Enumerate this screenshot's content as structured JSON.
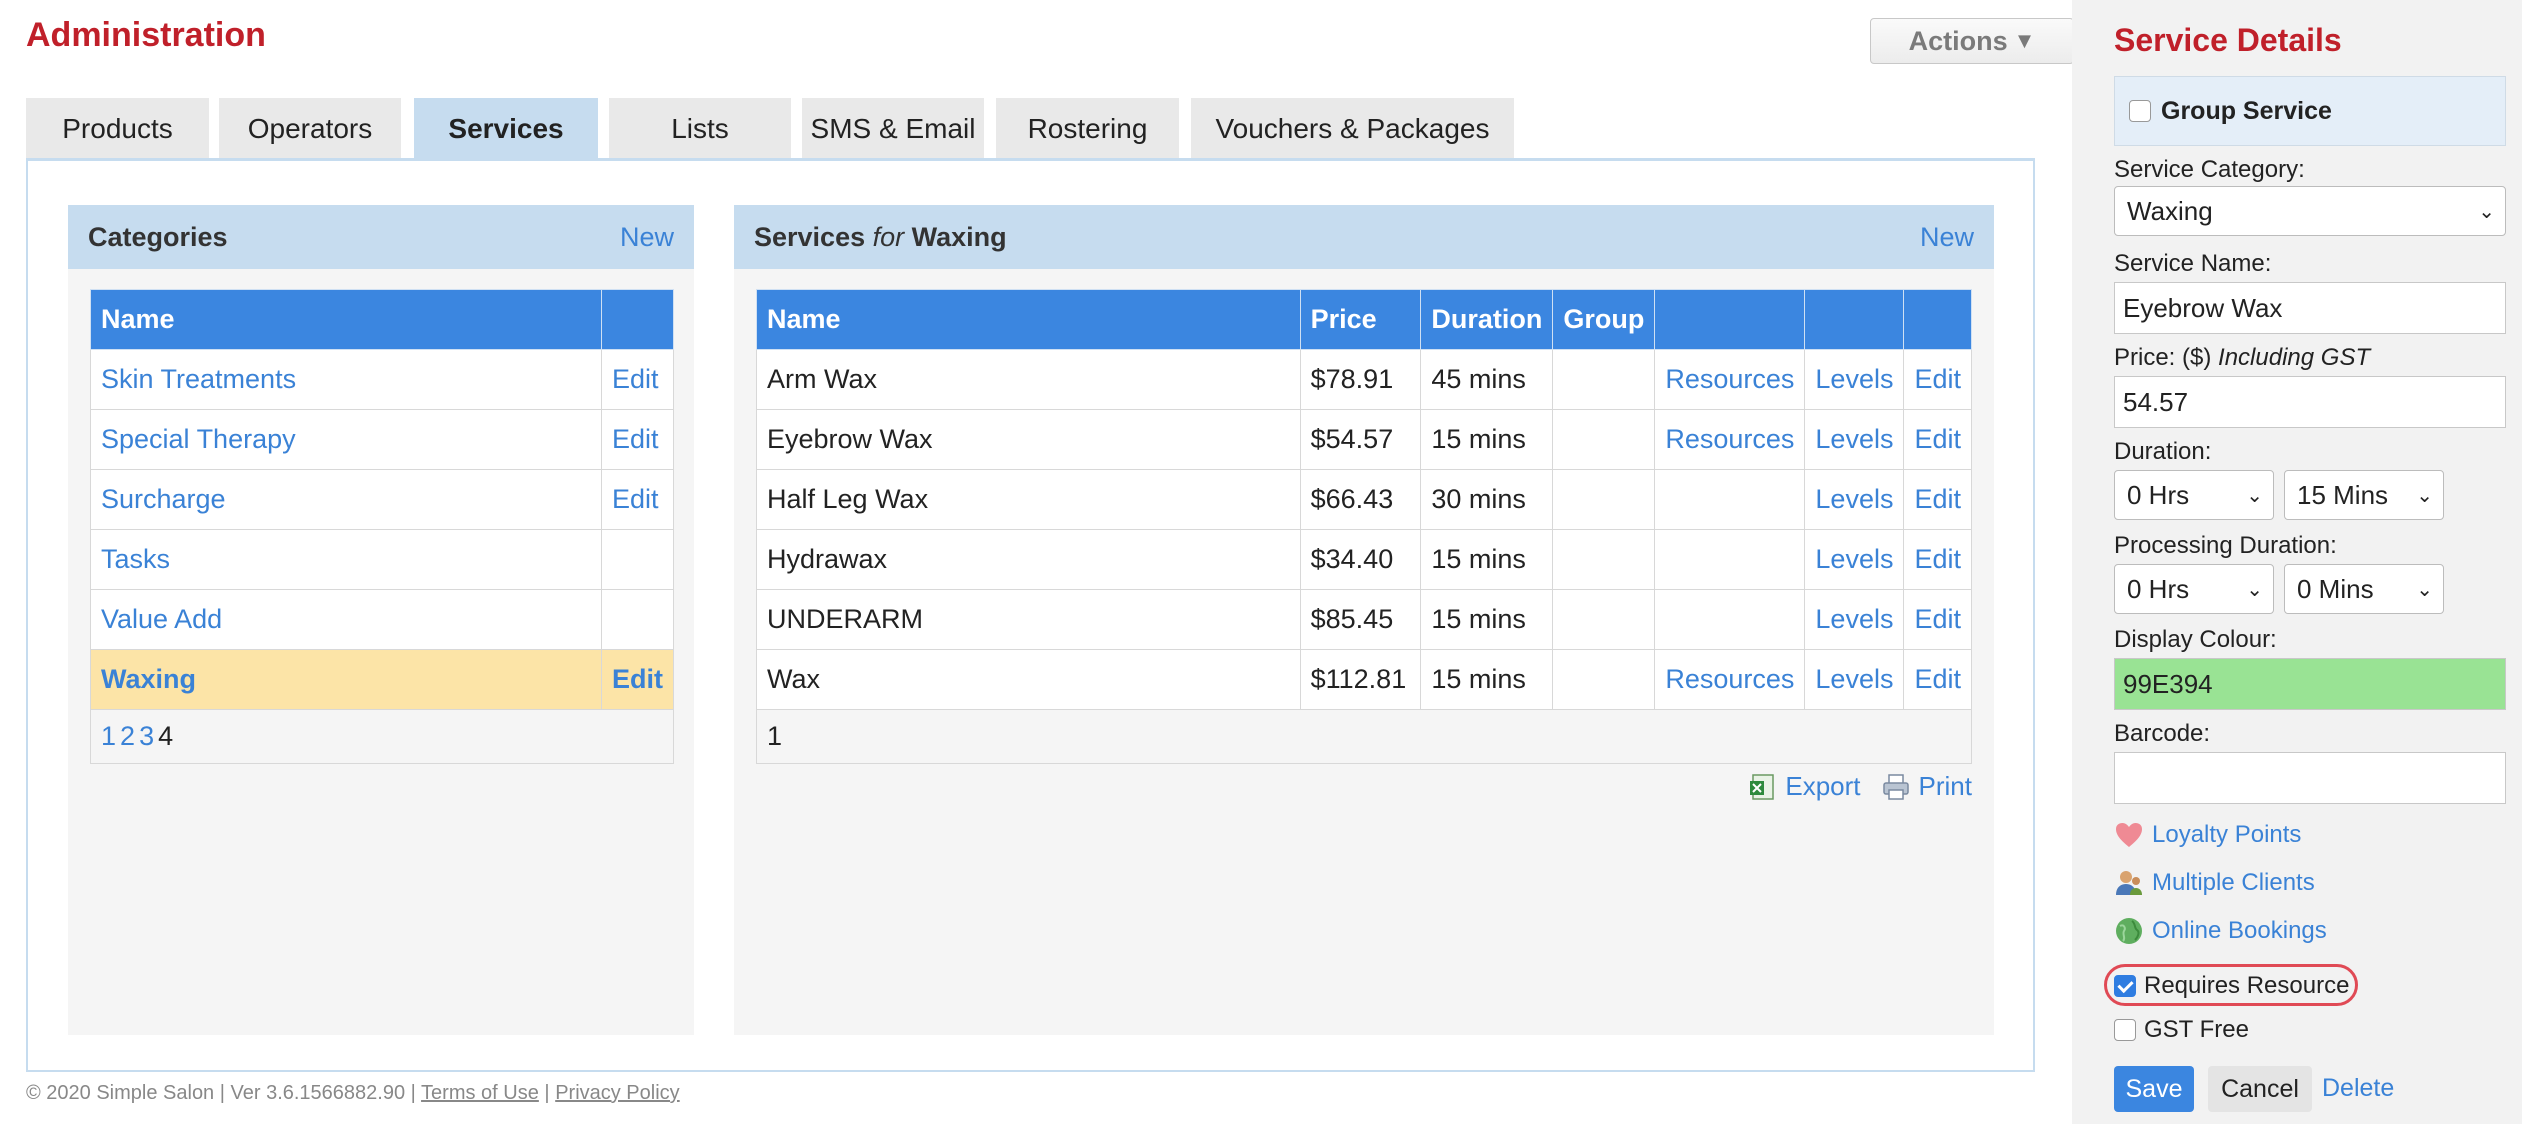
{
  "header": {
    "title": "Administration",
    "actions_label": "Actions",
    "actions_icon": "caret-down-icon"
  },
  "tabs": [
    {
      "label": "Products",
      "active": false
    },
    {
      "label": "Operators",
      "active": false
    },
    {
      "label": "Services",
      "active": true
    },
    {
      "label": "Lists",
      "active": false
    },
    {
      "label": "SMS & Email",
      "active": false
    },
    {
      "label": "Rostering",
      "active": false
    },
    {
      "label": "Vouchers & Packages",
      "active": false
    }
  ],
  "categories": {
    "title": "Categories",
    "new_label": "New",
    "column_name": "Name",
    "rows": [
      {
        "name": "Skin Treatments",
        "edit": "Edit"
      },
      {
        "name": "Special Therapy",
        "edit": "Edit"
      },
      {
        "name": "Surcharge",
        "edit": "Edit"
      },
      {
        "name": "Tasks",
        "edit": ""
      },
      {
        "name": "Value Add",
        "edit": ""
      },
      {
        "name": "Waxing",
        "edit": "Edit",
        "selected": true
      }
    ],
    "pager": [
      "1",
      "2",
      "3",
      "4"
    ],
    "pager_current": "4"
  },
  "services": {
    "title_prefix": "Services",
    "title_for": "for",
    "title_category": "Waxing",
    "new_label": "New",
    "columns": [
      "Name",
      "Price",
      "Duration",
      "Group",
      "",
      "",
      ""
    ],
    "rows": [
      {
        "name": "Arm Wax",
        "price": "$78.91",
        "duration": "45 mins",
        "group": "",
        "resources": "Resources",
        "levels": "Levels",
        "edit": "Edit"
      },
      {
        "name": "Eyebrow Wax",
        "price": "$54.57",
        "duration": "15 mins",
        "group": "",
        "resources": "Resources",
        "levels": "Levels",
        "edit": "Edit"
      },
      {
        "name": "Half Leg Wax",
        "price": "$66.43",
        "duration": "30 mins",
        "group": "",
        "resources": "",
        "levels": "Levels",
        "edit": "Edit"
      },
      {
        "name": "Hydrawax",
        "price": "$34.40",
        "duration": "15 mins",
        "group": "",
        "resources": "",
        "levels": "Levels",
        "edit": "Edit"
      },
      {
        "name": "UNDERARM",
        "price": "$85.45",
        "duration": "15 mins",
        "group": "",
        "resources": "",
        "levels": "Levels",
        "edit": "Edit"
      },
      {
        "name": "Wax",
        "price": "$112.81",
        "duration": "15 mins",
        "group": "",
        "resources": "Resources",
        "levels": "Levels",
        "edit": "Edit"
      }
    ],
    "pager": "1",
    "export_label": "Export",
    "print_label": "Print"
  },
  "footer": {
    "copyright": "© 2020 Simple Salon | Ver 3.6.1566882.90 |",
    "terms": "Terms of Use",
    "separator": "|",
    "privacy": "Privacy Policy"
  },
  "sidebar": {
    "title": "Service Details",
    "group_service_label": "Group Service",
    "group_service_checked": false,
    "category_label": "Service Category:",
    "category_value": "Waxing",
    "name_label": "Service Name:",
    "name_value": "Eyebrow Wax",
    "price_label": "Price: ($)",
    "price_note": "Including GST",
    "price_value": "54.57",
    "duration_label": "Duration:",
    "duration_hrs": "0 Hrs",
    "duration_mins": "15 Mins",
    "processing_label": "Processing Duration:",
    "processing_hrs": "0 Hrs",
    "processing_mins": "0 Mins",
    "colour_label": "Display Colour:",
    "colour_value": "99E394",
    "colour_hex": "#99E394",
    "barcode_label": "Barcode:",
    "barcode_value": "",
    "loyalty_label": "Loyalty Points",
    "multiple_clients_label": "Multiple Clients",
    "online_bookings_label": "Online Bookings",
    "requires_resource_label": "Requires Resource",
    "requires_resource_checked": true,
    "gst_free_label": "GST Free",
    "gst_free_checked": false,
    "save_label": "Save",
    "cancel_label": "Cancel",
    "delete_label": "Delete"
  },
  "colors": {
    "title_red": "#c0202a",
    "table_header_blue": "#3b86e0",
    "panel_header_blue": "#c6dcef",
    "selected_row": "#fce4a7",
    "link_blue": "#3a82d6"
  }
}
